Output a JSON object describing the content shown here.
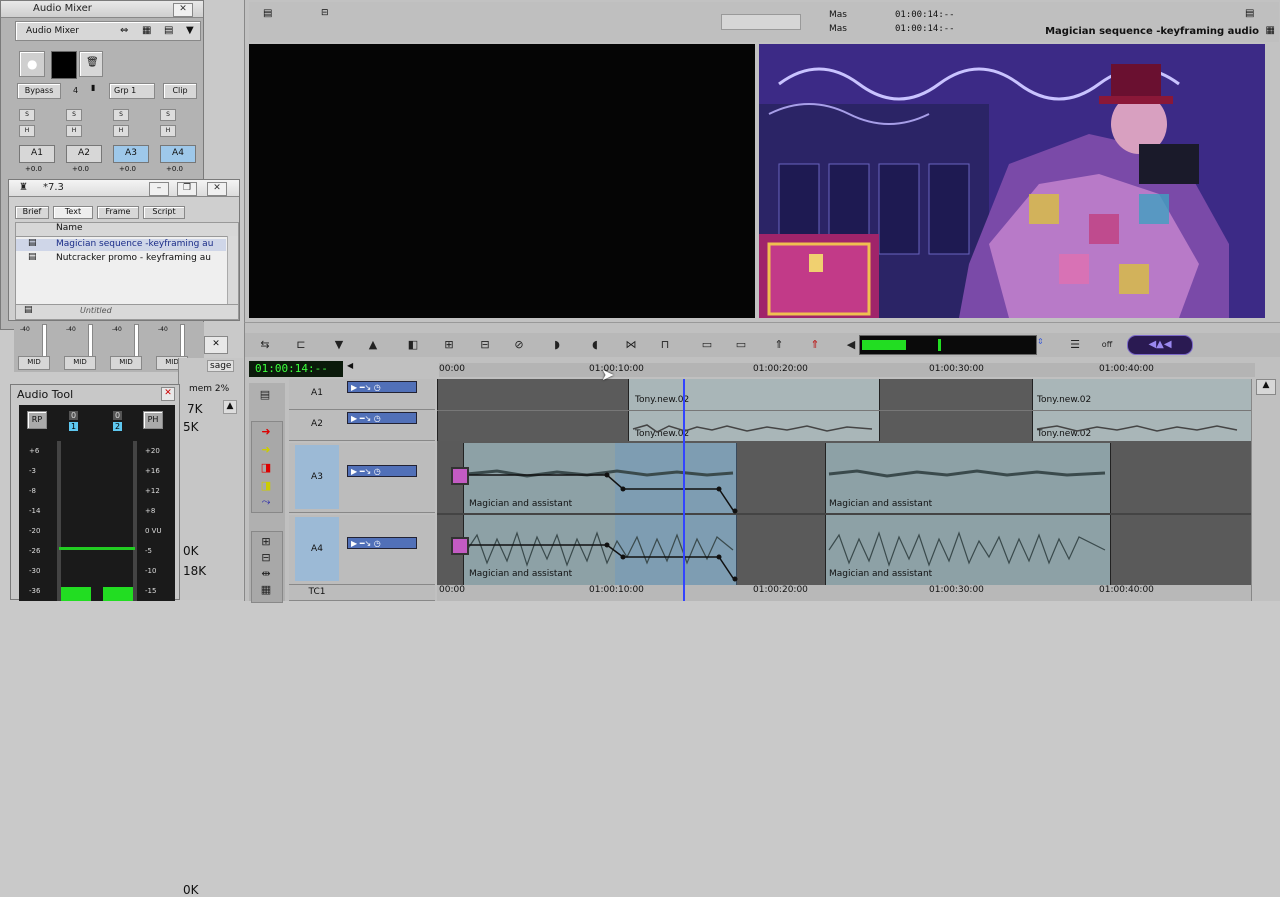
{
  "audio_mixer": {
    "title": "Audio Mixer",
    "header_label": "Audio Mixer",
    "bypass_label": "Bypass",
    "channel_value": "4",
    "group_label": "Grp 1",
    "clip_label": "Clip",
    "s_label": "S",
    "h_label": "H",
    "tracks": [
      "A1",
      "A2",
      "A3",
      "A4"
    ],
    "gain_labels": [
      "+0.0",
      "+0.0",
      "+0.0",
      "+0.0"
    ],
    "mid_labels": [
      "MID",
      "MID",
      "MID",
      "MID"
    ],
    "level_marks": [
      "-40",
      "-40",
      "-40",
      "-40"
    ]
  },
  "bin": {
    "title": "*7.3",
    "tabs": [
      "Brief",
      "Text",
      "Frame",
      "Script"
    ],
    "column_name": "Name",
    "items": [
      "Magician sequence -keyframing au",
      "Nutcracker promo - keyframing au"
    ],
    "status": "Untitled"
  },
  "audio_tool": {
    "title": "Audio Tool",
    "rp_label": "RP",
    "ph_label": "PH",
    "channels": [
      "1",
      "2"
    ],
    "ch_zero": [
      "0",
      "0"
    ],
    "left_scale": [
      "+6",
      "-3",
      "-8",
      "-14",
      "-20",
      "-26",
      "-30",
      "-36"
    ],
    "right_scale": [
      "+20",
      "+16",
      "+12",
      "+8",
      "0 VU",
      "-5",
      "-10",
      "-15"
    ]
  },
  "behind_panel": {
    "header": "mem 2%",
    "label": "sage",
    "values": [
      "7K",
      "5K",
      "0K",
      "0K",
      "18K"
    ]
  },
  "composer": {
    "mas_label": "Mas",
    "timecodes": [
      "01:00:14:--",
      "01:00:14:--"
    ],
    "sequence_name": "Magician sequence -keyframing audio"
  },
  "timeline": {
    "timecode": "01:00:14:--",
    "ruler_labels": [
      "00:00",
      "01:00:10:00",
      "01:00:20:00",
      "01:00:30:00",
      "01:00:40:00"
    ],
    "tracks": [
      "A1",
      "A2",
      "A3",
      "A4",
      "TC1"
    ],
    "clips": {
      "a1_clip_1": "Tony.new.02",
      "a1_clip_2": "Tony.new.02",
      "a2_clip_1": "Tony.new.02",
      "a2_clip_2": "Tony.new.02",
      "a3_clip_1": "Magician and assistant",
      "a3_clip_2": "Magician and assistant",
      "a4_clip_1": "Magician and assistant",
      "a4_clip_2": "Magician and assistant"
    },
    "tc_labels": [
      "00:00",
      "01:00:10:00",
      "01:00:20:00",
      "01:00:30:00",
      "01:00:40:00"
    ]
  },
  "colors": {
    "accent": "#7b68c8",
    "meter_green": "#22dd22",
    "timecode_green": "#3cff3c",
    "playhead": "#3344ff",
    "clip_a12": "#a9b6b8",
    "clip_a34": "#8da1a6"
  },
  "meter_levels": {
    "audio_tool_left": 0.09,
    "audio_tool_right": 0.09
  }
}
